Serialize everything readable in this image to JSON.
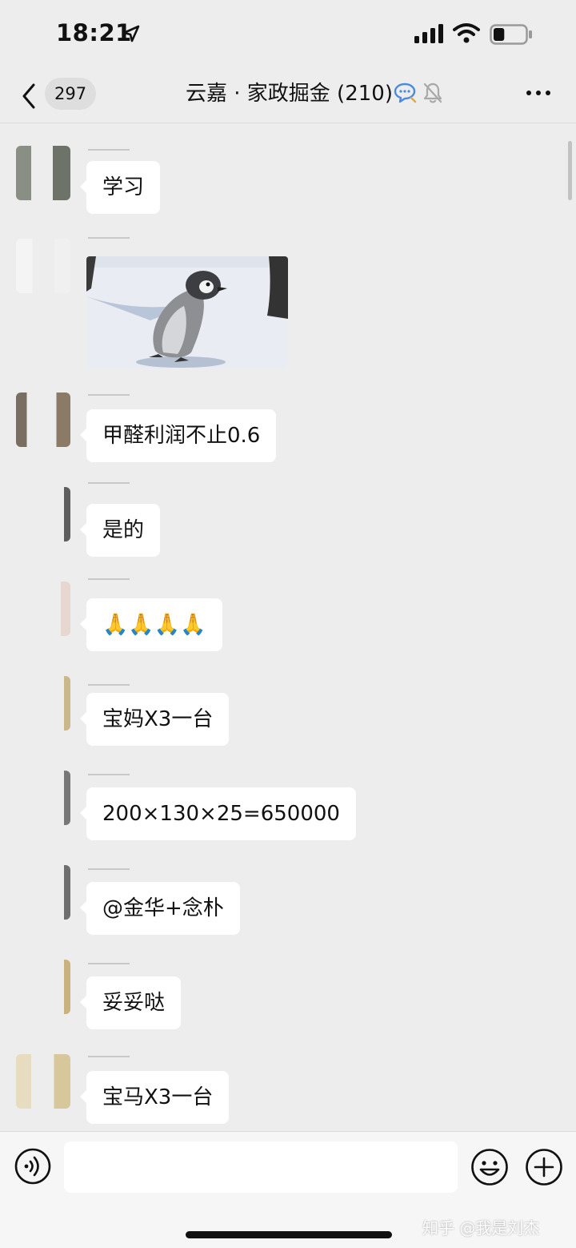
{
  "status_bar": {
    "time": "18:21",
    "battery_level": 0.35
  },
  "nav": {
    "unread_count": "297",
    "title": "云嘉 · 家政掘金 (210)",
    "icons": [
      "back-chevron-icon",
      "chat-bubble-icon",
      "mute-bell-icon",
      "more-dots-icon"
    ]
  },
  "messages": [
    {
      "type": "text",
      "text": "学习"
    },
    {
      "type": "sticker",
      "description_icon": "penguin-sticker"
    },
    {
      "type": "text",
      "text": "甲醛利润不止0.6"
    },
    {
      "type": "text",
      "text": "是的"
    },
    {
      "type": "text",
      "text": "🙏🙏🙏🙏"
    },
    {
      "type": "text",
      "text": "宝妈X3一台"
    },
    {
      "type": "text",
      "text": "200×130×25=650000"
    },
    {
      "type": "text",
      "text": "@金华+念朴"
    },
    {
      "type": "text",
      "text": "妥妥哒"
    },
    {
      "type": "text",
      "text": "宝马X3一台"
    }
  ],
  "input_bar": {
    "icons": [
      "voice-icon",
      "emoji-icon",
      "plus-icon"
    ],
    "watermark": "知乎 @我是刘杰"
  },
  "colors": {
    "background": "#ededed",
    "bubble": "#ffffff",
    "accent": "#4a8be0"
  }
}
